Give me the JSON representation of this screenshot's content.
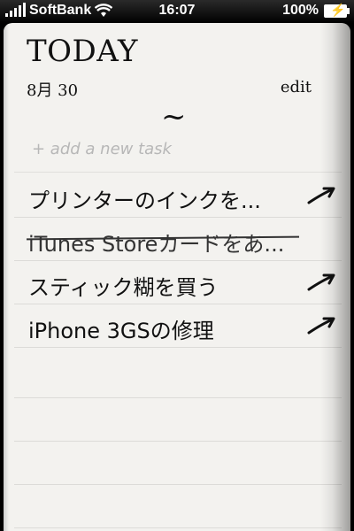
{
  "status_bar": {
    "carrier": "SoftBank",
    "time": "16:07",
    "battery": "100%"
  },
  "header": {
    "title": "TODAY",
    "date": "8月 30",
    "edit_label": "edit",
    "separator": "~"
  },
  "add_task": {
    "placeholder": "+ add a new task"
  },
  "tasks": [
    {
      "label": "プリンターのインクを...",
      "done": false,
      "icon": "arrow-icon"
    },
    {
      "label": "iTunes Storeカードをあ...",
      "done": true,
      "icon": null
    },
    {
      "label": "スティック糊を買う",
      "done": false,
      "icon": "arrow-icon"
    },
    {
      "label": "iPhone 3GSの修理",
      "done": false,
      "icon": "arrow-icon"
    }
  ],
  "colors": {
    "page": "#f3f2ef",
    "text": "#111111",
    "placeholder": "#b7b7b7",
    "rule": "#dcdbd8"
  }
}
